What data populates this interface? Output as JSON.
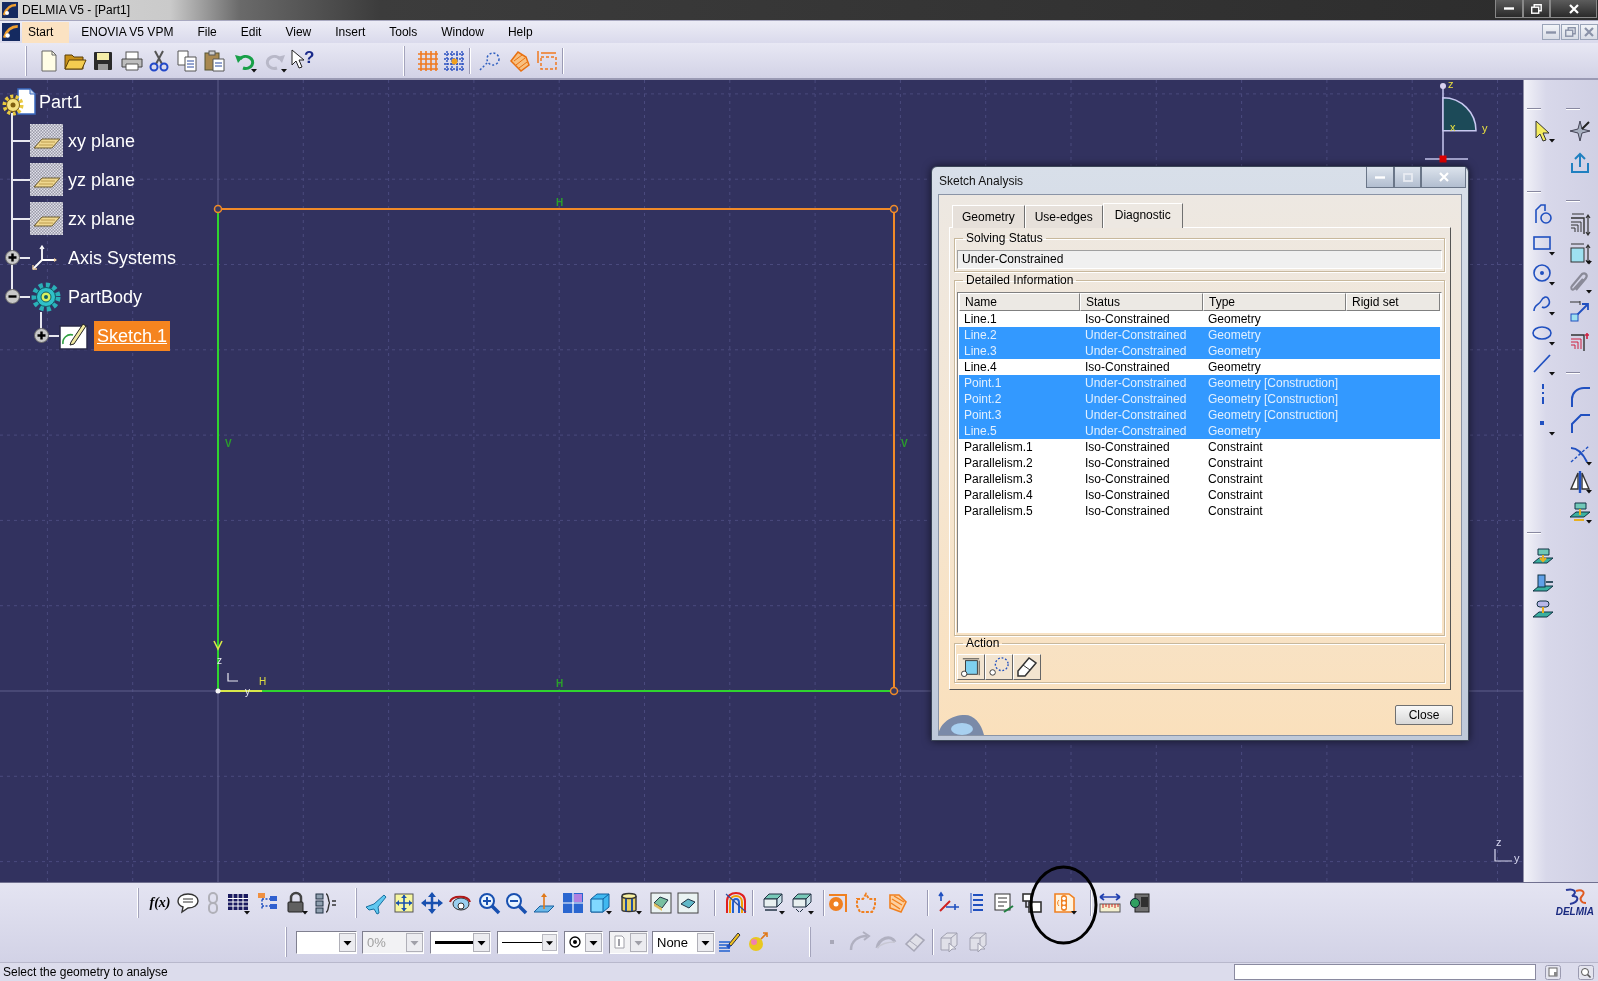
{
  "window": {
    "title": "DELMIA V5 - [Part1]"
  },
  "menu_bar": {
    "items": [
      {
        "label": "Start",
        "selected": true
      },
      {
        "label": "ENOVIA V5 VPM",
        "selected": false
      },
      {
        "label": "File",
        "selected": false
      },
      {
        "label": "Edit",
        "selected": false
      },
      {
        "label": "View",
        "selected": false
      },
      {
        "label": "Insert",
        "selected": false
      },
      {
        "label": "Tools",
        "selected": false
      },
      {
        "label": "Window",
        "selected": false
      },
      {
        "label": "Help",
        "selected": false
      }
    ]
  },
  "standard_toolbar": {
    "help_button": {
      "label": "?"
    }
  },
  "spec_tree": {
    "root": {
      "label": "Part1",
      "kind": "part",
      "selected": false,
      "children": [
        {
          "label": "xy plane",
          "kind": "plane",
          "selected": false
        },
        {
          "label": "yz plane",
          "kind": "plane",
          "selected": false
        },
        {
          "label": "zx plane",
          "kind": "plane",
          "selected": false
        },
        {
          "label": "Axis Systems",
          "kind": "axis_system",
          "selected": false,
          "expanded": false
        },
        {
          "label": "PartBody",
          "kind": "body",
          "selected": false,
          "expanded": true,
          "children": [
            {
              "label": "Sketch.1",
              "kind": "sketch",
              "selected": true,
              "expanded": false
            }
          ]
        }
      ]
    }
  },
  "sketch": {
    "edges": [
      {
        "color": "#f08a28"
      },
      {
        "color": "#f08a28"
      },
      {
        "color": "#2fd42f"
      },
      {
        "color": "#2fd42f"
      }
    ],
    "constraints": [
      {
        "label": "H"
      },
      {
        "label": "V"
      },
      {
        "label": "V"
      },
      {
        "label": "H"
      }
    ],
    "origin": {
      "vertical_label": "z",
      "horizontal_label": "y",
      "direction_label": "H"
    }
  },
  "compass": {
    "z_label": "z",
    "x_label": "x",
    "y_label": "y"
  },
  "view_axis": {
    "z_label": "z",
    "y_label": "y"
  },
  "dialog": {
    "title": "Sketch Analysis",
    "tabs": [
      {
        "label": "Geometry",
        "selected": false
      },
      {
        "label": "Use-edges",
        "selected": false
      },
      {
        "label": "Diagnostic",
        "selected": true
      }
    ],
    "solving_status": {
      "label": "Solving Status",
      "value": "Under-Constrained"
    },
    "detailed_information": {
      "label": "Detailed Information",
      "columns": [
        "Name",
        "Status",
        "Type",
        "Rigid set"
      ],
      "rows": [
        {
          "name": "Line.1",
          "status": "Iso-Constrained",
          "type": "Geometry",
          "selected": false
        },
        {
          "name": "Line.2",
          "status": "Under-Constrained",
          "type": "Geometry",
          "selected": true
        },
        {
          "name": "Line.3",
          "status": "Under-Constrained",
          "type": "Geometry",
          "selected": true
        },
        {
          "name": "Line.4",
          "status": "Iso-Constrained",
          "type": "Geometry",
          "selected": false
        },
        {
          "name": "Point.1",
          "status": "Under-Constrained",
          "type": "Geometry [Construction]",
          "selected": true
        },
        {
          "name": "Point.2",
          "status": "Under-Constrained",
          "type": "Geometry [Construction]",
          "selected": true
        },
        {
          "name": "Point.3",
          "status": "Under-Constrained",
          "type": "Geometry [Construction]",
          "selected": true
        },
        {
          "name": "Line.5",
          "status": "Under-Constrained",
          "type": "Geometry",
          "selected": true
        },
        {
          "name": "Parallelism.1",
          "status": "Iso-Constrained",
          "type": "Constraint",
          "selected": false
        },
        {
          "name": "Parallelism.2",
          "status": "Iso-Constrained",
          "type": "Constraint",
          "selected": false
        },
        {
          "name": "Parallelism.3",
          "status": "Iso-Constrained",
          "type": "Constraint",
          "selected": false
        },
        {
          "name": "Parallelism.4",
          "status": "Iso-Constrained",
          "type": "Constraint",
          "selected": false
        },
        {
          "name": "Parallelism.5",
          "status": "Iso-Constrained",
          "type": "Constraint",
          "selected": false
        }
      ]
    },
    "action": {
      "label": "Action"
    },
    "close_button": {
      "label": "Close"
    }
  },
  "view_toolbar": {
    "formula_button": {
      "label": "f(x)"
    }
  },
  "properties_toolbar": {
    "dropdowns": [
      {
        "kind": "blank",
        "disabled": false
      },
      {
        "kind": "text",
        "value": "0%",
        "disabled": true
      },
      {
        "kind": "line",
        "disabled": false
      },
      {
        "kind": "thin_line",
        "disabled": false
      },
      {
        "kind": "point",
        "disabled": false
      },
      {
        "kind": "layer",
        "disabled": true
      },
      {
        "kind": "text",
        "value": "None",
        "disabled": false
      }
    ]
  },
  "logo": {
    "text": "DELMIA"
  },
  "status_bar": {
    "message": "Select the geometry to analyse"
  }
}
